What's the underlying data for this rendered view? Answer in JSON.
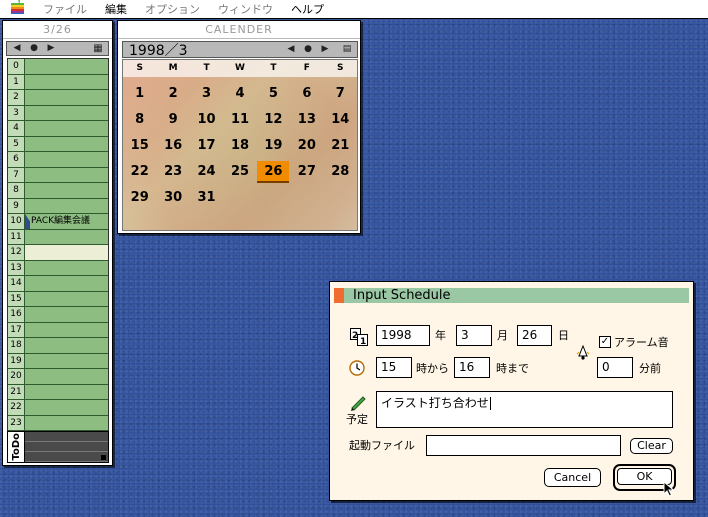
{
  "menubar": {
    "apple_icon": "apple-icon",
    "items": [
      {
        "label": "ファイル",
        "active": false
      },
      {
        "label": "編集",
        "active": true
      },
      {
        "label": "オプション",
        "active": false
      },
      {
        "label": "ウィンドウ",
        "active": false
      },
      {
        "label": "ヘルプ",
        "active": true
      }
    ]
  },
  "day_window": {
    "title": "3/26",
    "hours": [
      "0",
      "1",
      "2",
      "3",
      "4",
      "5",
      "6",
      "7",
      "8",
      "9",
      "10",
      "11",
      "12",
      "13",
      "14",
      "15",
      "16",
      "17",
      "18",
      "19",
      "20",
      "21",
      "22",
      "23"
    ],
    "event": {
      "hour": "10",
      "text": "PACK編集会議"
    },
    "current_hour": "12",
    "todo_label": "ToDo"
  },
  "calendar_window": {
    "title": "CALENDER",
    "month_label": "1998／3",
    "weekdays": [
      "S",
      "M",
      "T",
      "W",
      "T",
      "F",
      "S"
    ],
    "days": [
      "1",
      "2",
      "3",
      "4",
      "5",
      "6",
      "7",
      "8",
      "9",
      "10",
      "11",
      "12",
      "13",
      "14",
      "15",
      "16",
      "17",
      "18",
      "19",
      "20",
      "21",
      "22",
      "23",
      "24",
      "25",
      "26",
      "27",
      "28",
      "29",
      "30",
      "31"
    ],
    "today": "26"
  },
  "dialog": {
    "title": "Input Schedule",
    "year_value": "1998",
    "year_label": "年",
    "month_value": "3",
    "month_label": "月",
    "day_value": "26",
    "day_label": "日",
    "alarm_checked": true,
    "alarm_label": "アラーム音",
    "start_value": "15",
    "start_label": "時から",
    "end_value": "16",
    "end_label": "時まで",
    "alarm_before_value": "0",
    "alarm_before_label": "分前",
    "plan_label": "予定",
    "plan_value": "イラスト打ち合わせ",
    "launch_label": "起動ファイル",
    "launch_value": "",
    "clear_label": "Clear",
    "cancel_label": "Cancel",
    "ok_label": "OK"
  },
  "colors": {
    "desktop": "#2f4f9b",
    "hour_row": "#8ebd82",
    "today": "#f18b00",
    "dialog_title": "#9ac8a5",
    "dialog_mark": "#ef6b2f",
    "dialog_bg": "#fff6e7"
  }
}
